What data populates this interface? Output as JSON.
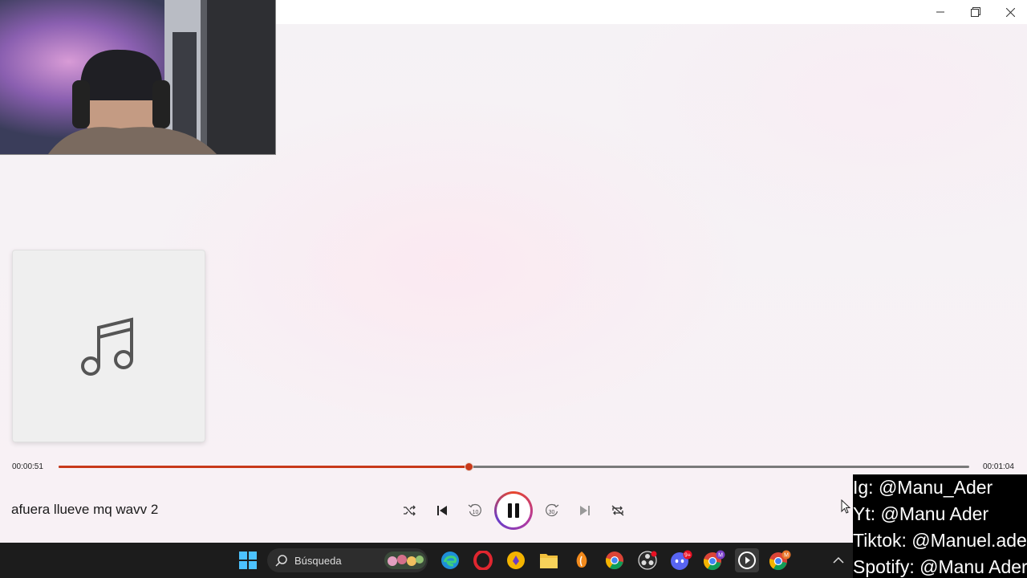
{
  "window": {
    "minimize_icon": "minimize-icon",
    "maximize_icon": "restore-icon",
    "close_icon": "close-icon"
  },
  "webcam": {
    "description_icon": "webcam-feed"
  },
  "album_art": {
    "icon": "music-note-icon"
  },
  "player": {
    "elapsed": "00:00:51",
    "total": "00:01:04",
    "progress_fraction": 0.45,
    "song_title": "afuera llueve mq wavv 2",
    "controls": [
      {
        "name": "shuffle",
        "icon": "shuffle-icon"
      },
      {
        "name": "previous",
        "icon": "previous-icon"
      },
      {
        "name": "rewind-10",
        "icon": "rewind-10-icon",
        "label": "10"
      },
      {
        "name": "pause",
        "icon": "pause-icon"
      },
      {
        "name": "forward-30",
        "icon": "forward-30-icon",
        "label": "30"
      },
      {
        "name": "next",
        "icon": "next-icon"
      },
      {
        "name": "repeat",
        "icon": "repeat-icon"
      }
    ],
    "accent_color": "#c8391a"
  },
  "overlay": {
    "line1": "Ig: @Manu_Ader",
    "line2": "Yt: @Manu Ader",
    "line3": "Tiktok: @Manuel.ader",
    "line4": "Spotify: @Manu Ader"
  },
  "taskbar": {
    "search_placeholder": "Búsqueda",
    "icons": [
      "windows-start-icon",
      "search-icon",
      "widgets-icon",
      "edge-icon",
      "opera-icon",
      "vpn-icon",
      "file-explorer-icon",
      "fl-studio-icon",
      "chrome-icon",
      "obs-icon",
      "discord-icon",
      "chrome-profile-icon",
      "media-player-icon",
      "chrome-profile-2-icon",
      "chevron-up-icon"
    ],
    "discord_badge": "9+",
    "chrome_badge_1": "M",
    "chrome_badge_2": "M"
  }
}
